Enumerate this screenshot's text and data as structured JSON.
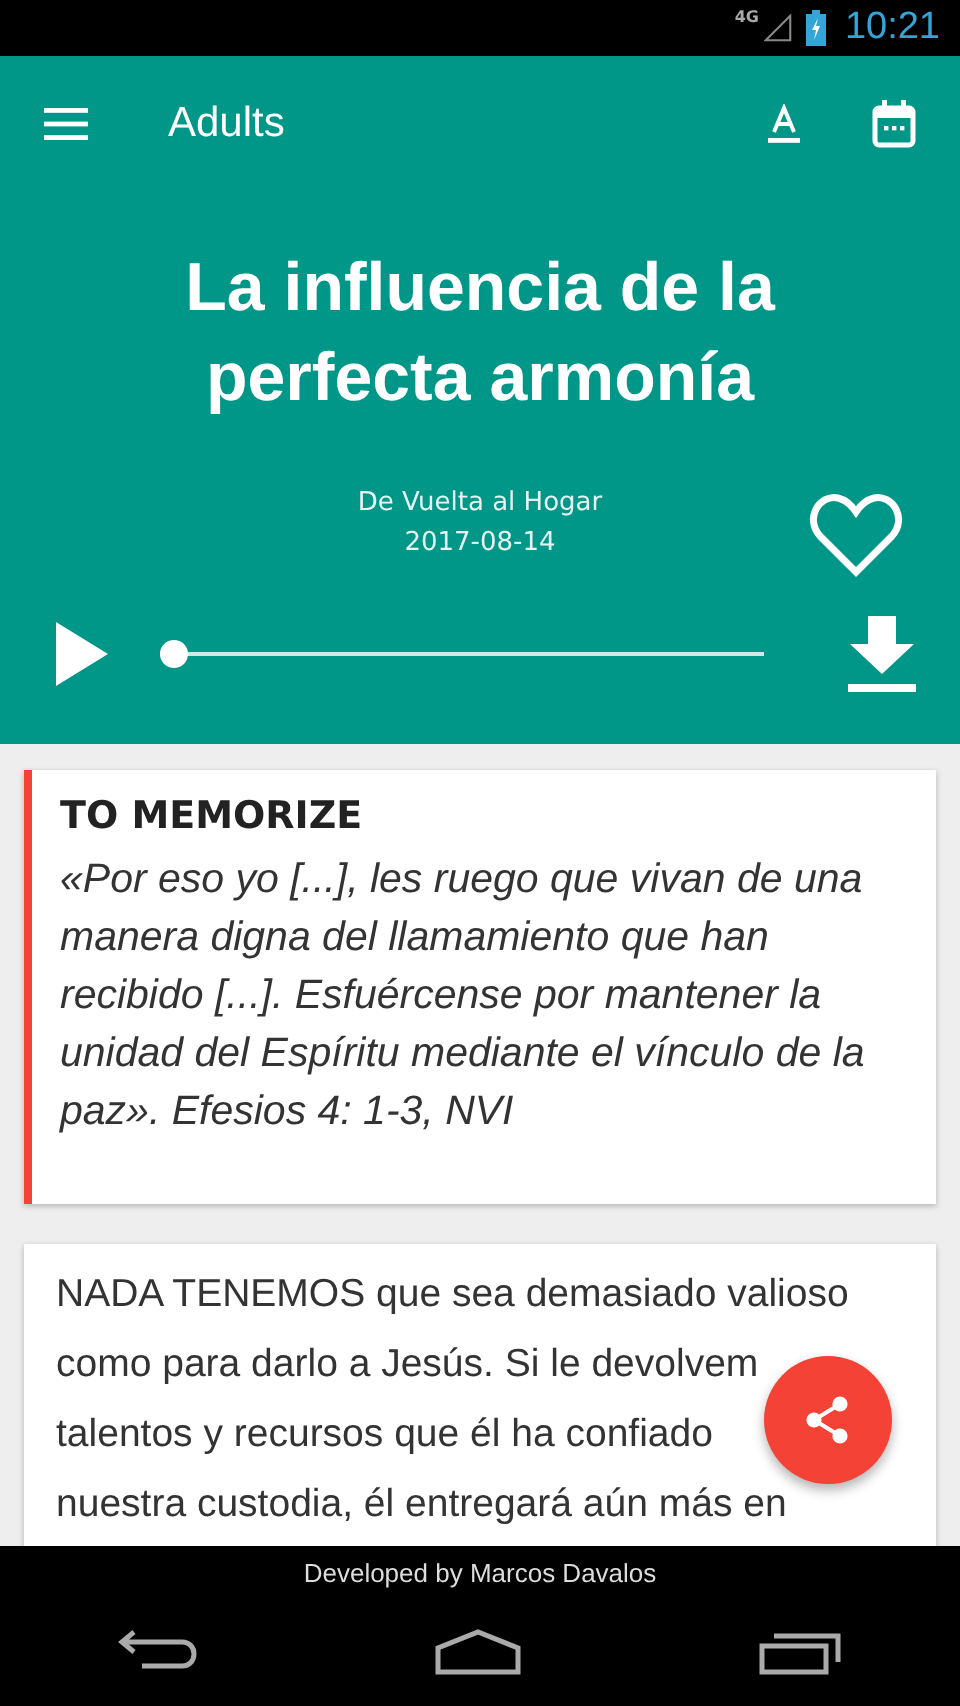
{
  "status_bar": {
    "network": "4G",
    "time": "10:21"
  },
  "toolbar": {
    "title": "Adults"
  },
  "lesson": {
    "title": "La influencia de la perfecta armonía",
    "source": "De Vuelta al Hogar",
    "date": "2017-08-14",
    "favorite": false
  },
  "player": {
    "level": 0
  },
  "memorize": {
    "heading": "TO MEMORIZE",
    "text": "«Por eso yo [...], les ruego que vivan de una manera digna del llamamiento que han recibido [...]. Esfuércense por mantener la unidad del Espíritu mediante el vínculo de la paz». Efesios 4: 1-3, NVI"
  },
  "body": {
    "lines": [
      "NADA TENEMOS que sea demasiado valioso",
      "como para darlo a Jesús. Si le devolvem",
      "talentos y recursos que él ha confiado",
      "nuestra custodia, él entregará aún más en"
    ]
  },
  "footer": {
    "credit": "Developed by Marcos Davalos"
  }
}
